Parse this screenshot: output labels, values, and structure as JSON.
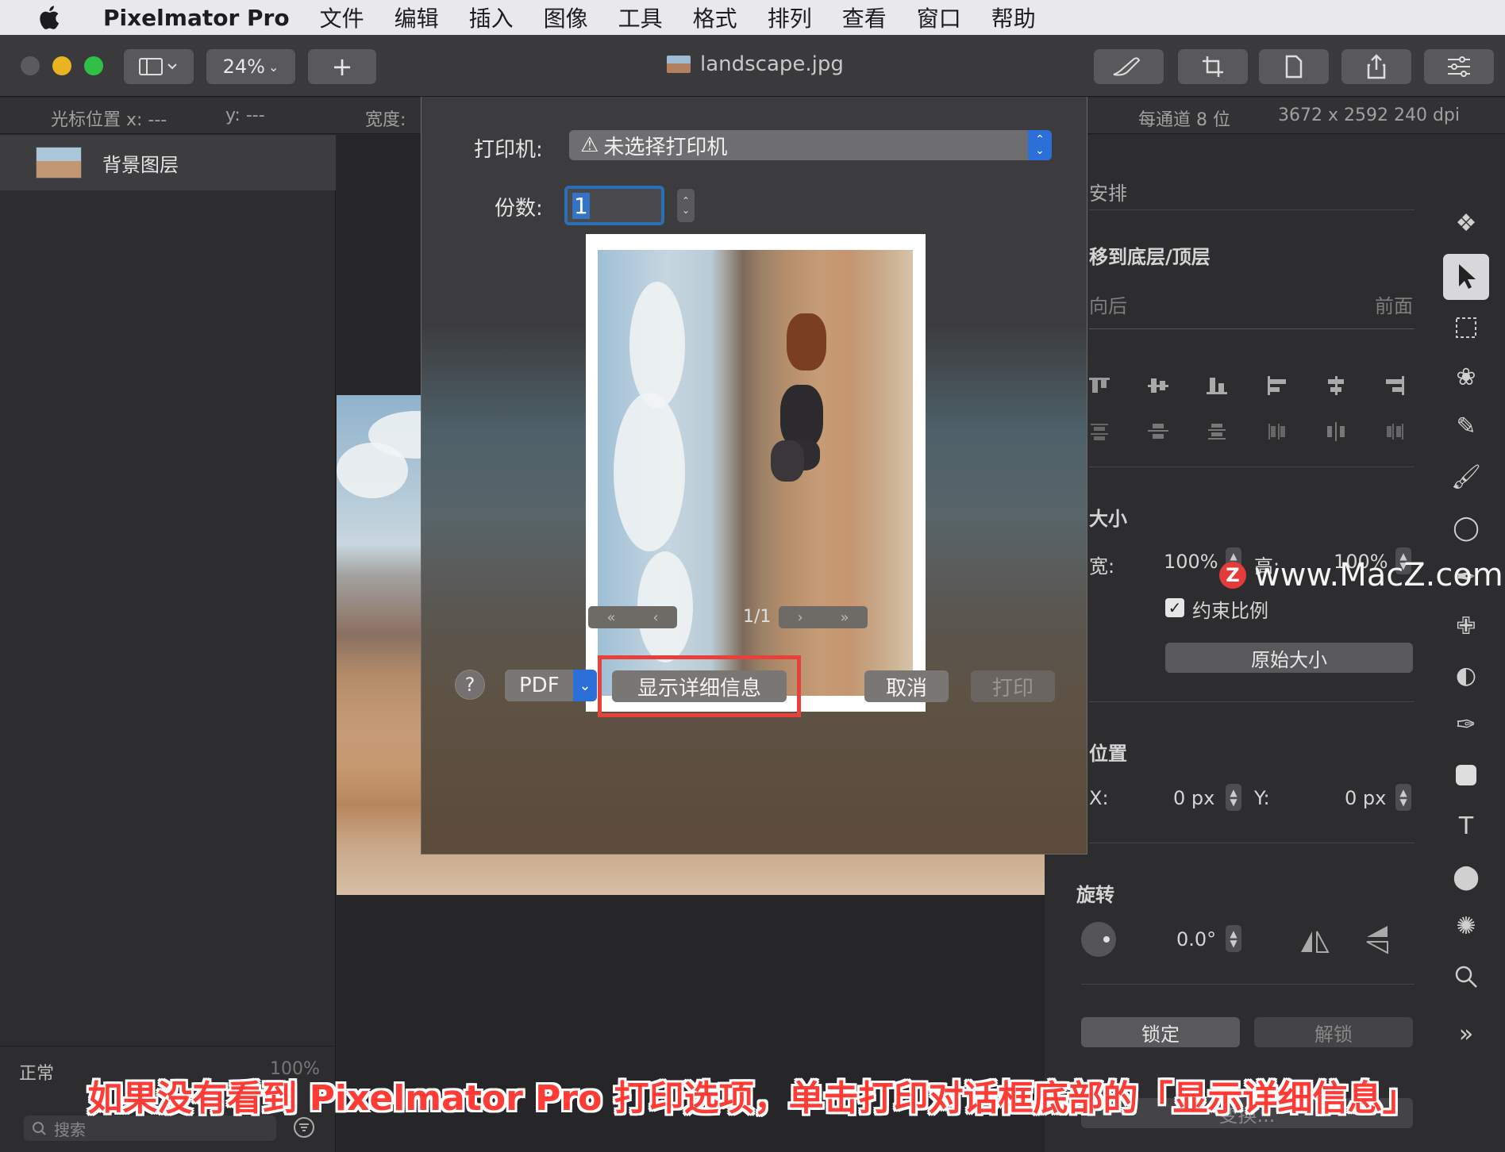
{
  "menubar": {
    "app_name": "Pixelmator Pro",
    "items": [
      "文件",
      "编辑",
      "插入",
      "图像",
      "工具",
      "格式",
      "排列",
      "查看",
      "窗口",
      "帮助"
    ]
  },
  "toolbar": {
    "zoom": "24%",
    "add_label": "+",
    "document_title": "landscape.jpg"
  },
  "infobar": {
    "cursor_x": "光标位置 x: ---",
    "cursor_y": "y: ---",
    "width_label": "宽度:",
    "bit_depth": "每通道 8 位",
    "dimensions": "3672 x 2592 240 dpi"
  },
  "layers": {
    "items": [
      {
        "name": "背景图层"
      }
    ],
    "blend_mode": "正常",
    "opacity": "100%",
    "search_placeholder": "搜索"
  },
  "arrange_panel": {
    "header": "安排",
    "move_label": "移到底层/顶层",
    "back_label": "向后",
    "front_label": "前面",
    "size_header": "大小",
    "width_label": "宽:",
    "width_value": "100%",
    "height_label": "高:",
    "height_value": "100%",
    "constrain_label": "约束比例",
    "original_size_button": "原始大小",
    "position_header": "位置",
    "x_label": "X:",
    "x_value": "0 px",
    "y_label": "Y:",
    "y_value": "0 px",
    "rotate_header": "旋转",
    "rotate_value": "0.0°",
    "lock_button": "锁定",
    "unlock_button": "解锁",
    "transform_button": "变换..."
  },
  "print_dialog": {
    "printer_label": "打印机:",
    "printer_value": "未选择打印机",
    "copies_label": "份数:",
    "copies_value": "1",
    "page_indicator": "1/1",
    "help_label": "?",
    "pdf_label": "PDF",
    "show_details_button": "显示详细信息",
    "cancel_button": "取消",
    "print_button": "打印"
  },
  "watermark": {
    "logo_letter": "Z",
    "text": "www.MacZ.com"
  },
  "caption": "如果没有看到 Pixelmator Pro 打印选项，单击打印对话框底部的「显示详细信息」",
  "colors": {
    "accent_blue": "#2d6fd8",
    "highlight_red": "#e8403a",
    "caption_red": "#ff3b35"
  }
}
